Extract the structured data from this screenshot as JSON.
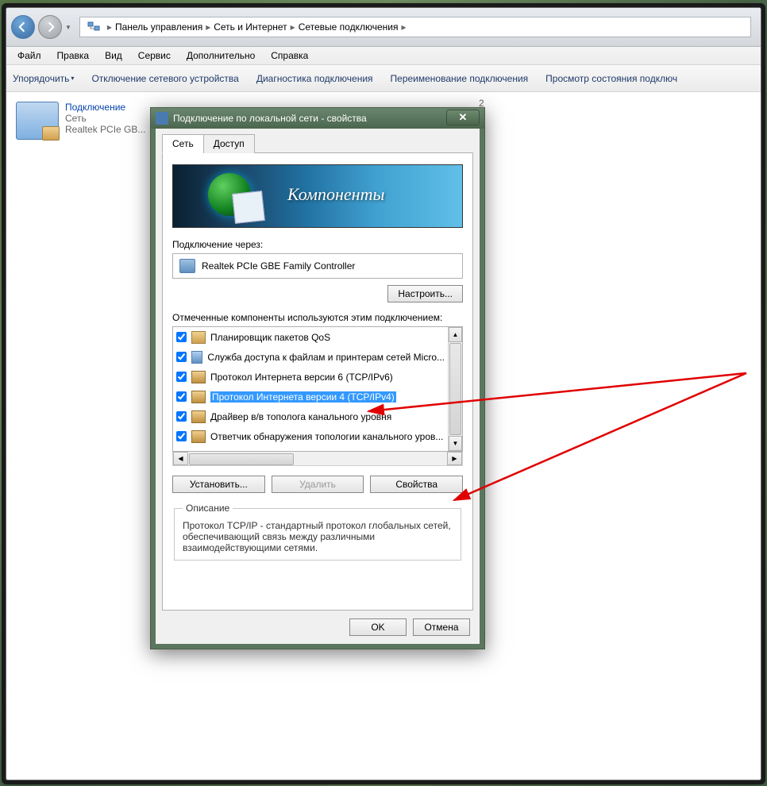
{
  "breadcrumb": {
    "items": [
      "Панель управления",
      "Сеть и Интернет",
      "Сетевые подключения"
    ]
  },
  "menu": {
    "file": "Файл",
    "edit": "Правка",
    "view": "Вид",
    "tools": "Сервис",
    "advanced": "Дополнительно",
    "help": "Справка"
  },
  "toolbar": {
    "organize": "Упорядочить",
    "disable": "Отключение сетевого устройства",
    "diagnose": "Диагностика подключения",
    "rename": "Переименование подключения",
    "status": "Просмотр состояния подключ"
  },
  "connections": {
    "item1": {
      "title": "Подключение",
      "sub1": "Сеть",
      "sub2": "Realtek PCIe GB..."
    },
    "item2_suffix": " 2"
  },
  "dialog": {
    "title": "Подключение по локальной сети - свойства",
    "tabs": {
      "network": "Сеть",
      "access": "Доступ"
    },
    "banner_text": "Компоненты",
    "connect_using_label": "Подключение через:",
    "adapter": "Realtek PCIe GBE Family Controller",
    "configure_btn": "Настроить...",
    "components_label": "Отмеченные компоненты используются этим подключением:",
    "components": [
      {
        "label": "Планировщик пакетов QoS",
        "icon": "sched",
        "checked": true,
        "sel": false
      },
      {
        "label": "Служба доступа к файлам и принтерам сетей Micro...",
        "icon": "share",
        "checked": true,
        "sel": false
      },
      {
        "label": "Протокол Интернета версии 6 (TCP/IPv6)",
        "icon": "proto",
        "checked": true,
        "sel": false
      },
      {
        "label": "Протокол Интернета версии 4 (TCP/IPv4)",
        "icon": "proto",
        "checked": true,
        "sel": true
      },
      {
        "label": "Драйвер в/в тополога канального уровня",
        "icon": "proto",
        "checked": true,
        "sel": false
      },
      {
        "label": "Ответчик обнаружения топологии канального уров...",
        "icon": "proto",
        "checked": true,
        "sel": false
      }
    ],
    "install_btn": "Установить...",
    "uninstall_btn": "Удалить",
    "properties_btn": "Свойства",
    "description_legend": "Описание",
    "description_text": "Протокол TCP/IP - стандартный протокол глобальных сетей, обеспечивающий связь между различными взаимодействующими сетями.",
    "ok_btn": "OK",
    "cancel_btn": "Отмена"
  }
}
